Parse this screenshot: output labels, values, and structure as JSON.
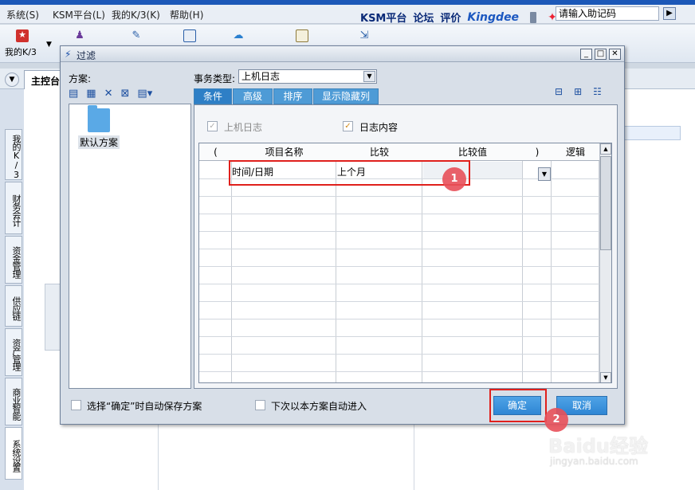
{
  "menu": {
    "items": [
      "系统(S)",
      "KSM平台(L)",
      "我的K/3(K)",
      "帮助(H)"
    ]
  },
  "brand": {
    "items": [
      "KSM平台",
      "论坛",
      "评价",
      "Kingdee"
    ]
  },
  "helpcode": {
    "placeholder": "请输入助记码"
  },
  "toolbar": {
    "my_k3": "我的K/3",
    "icons": [
      "star-icon",
      "users-icon",
      "pen-icon",
      "calculator-icon",
      "chat-icon",
      "edit-icon",
      "export-icon"
    ]
  },
  "main_tab": {
    "label": "主控台"
  },
  "vtabs": [
    "我的K/3",
    "财务会计",
    "资金管理",
    "供应链",
    "资产管理",
    "商业智能",
    "系统设置"
  ],
  "dialog": {
    "title": "过滤",
    "plan_label": "方案:",
    "plan_default": "默认方案",
    "biz_type_label": "事务类型:",
    "biz_type_value": "上机日志",
    "tabs": [
      "条件",
      "高级",
      "排序",
      "显示隐藏列"
    ],
    "check_login_log": "上机日志",
    "check_log_content": "日志内容",
    "grid": {
      "headers": [
        "(",
        "项目名称",
        "比较",
        "比较值",
        ")",
        "逻辑"
      ],
      "row1": {
        "field": "时间/日期",
        "compare": "上个月"
      }
    },
    "save_plan_label": "选择“确定”时自动保存方案",
    "auto_enter_label": "下次以本方案自动进入",
    "ok_label": "确定",
    "cancel_label": "取消"
  },
  "annotations": {
    "marker1": "1",
    "marker2": "2"
  },
  "watermark": {
    "main": "Baidu经验",
    "sub": "jingyan.baidu.com"
  },
  "colors": {
    "accent": "#2e86d4",
    "highlight": "#e0201c",
    "marker": "#e8515a"
  }
}
